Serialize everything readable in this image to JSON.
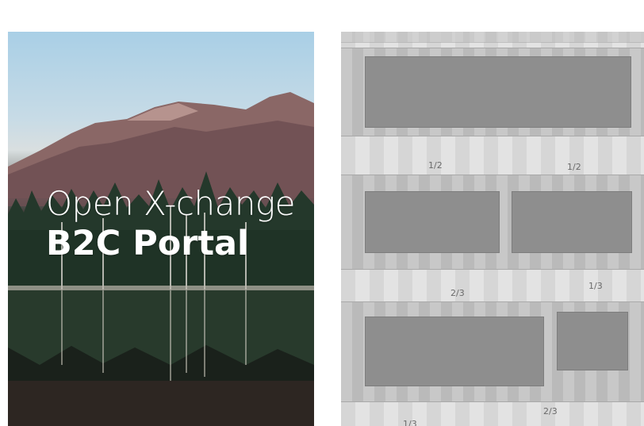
{
  "hero": {
    "title": "Open X-change",
    "subtitle": "B2C Portal"
  },
  "grid": {
    "labels": [
      {
        "text": "1/2"
      },
      {
        "text": "1/2"
      },
      {
        "text": "2/3"
      },
      {
        "text": "1/3"
      },
      {
        "text": "1/3"
      },
      {
        "text": "2/3"
      }
    ]
  },
  "colors": {
    "sky": "#a9cfe6",
    "mountain": "#7a5a5c",
    "forest": "#1d2a20",
    "grid_block": "#8e8e8e",
    "grid_band": "#c2c2c2"
  }
}
